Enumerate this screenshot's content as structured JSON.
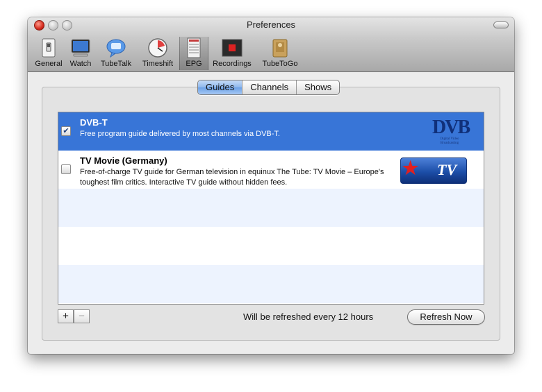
{
  "window": {
    "title": "Preferences"
  },
  "toolbar": {
    "items": [
      {
        "label": "General",
        "icon": "switch-icon"
      },
      {
        "label": "Watch",
        "icon": "monitor-icon"
      },
      {
        "label": "TubeTalk",
        "icon": "chat-bubble-icon"
      },
      {
        "label": "Timeshift",
        "icon": "gauge-icon"
      },
      {
        "label": "EPG",
        "icon": "guide-list-icon",
        "selected": true
      },
      {
        "label": "Recordings",
        "icon": "record-icon"
      },
      {
        "label": "TubeToGo",
        "icon": "package-icon"
      }
    ]
  },
  "tabs": [
    {
      "label": "Guides",
      "active": true
    },
    {
      "label": "Channels"
    },
    {
      "label": "Shows"
    }
  ],
  "guides": [
    {
      "name": "DVB-T",
      "description": "Free program guide delivered by most channels via DVB-T.",
      "checked": true,
      "logo": {
        "text": "DVB",
        "subtext": "Digital Video Broadcasting"
      }
    },
    {
      "name": "TV Movie (Germany)",
      "description": "Free-of-charge TV guide for German television in equinux The Tube: TV Movie – Europe's toughest film critics. Interactive TV guide without hidden fees.",
      "checked": false,
      "logo": {
        "text": "TV Movie"
      }
    }
  ],
  "footer": {
    "add_label": "+",
    "remove_label": "−",
    "refresh_text": "Will be refreshed every 12 hours",
    "refresh_button": "Refresh Now"
  },
  "colors": {
    "selection": "#3875d7",
    "tab_active": "#8db6ec",
    "alt_row": "#edf3fe"
  }
}
